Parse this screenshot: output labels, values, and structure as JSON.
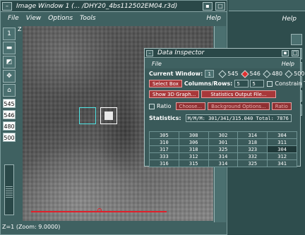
{
  "image_window": {
    "title": "Image Window 1 (... /DHY20_4bs112502EM04.r3d)",
    "menu": [
      "File",
      "View",
      "Options",
      "Tools"
    ],
    "help": "Help",
    "z_label": "Z",
    "tool_number": "1",
    "wavelengths": [
      "545",
      "546",
      "480",
      "500"
    ],
    "status": "Z=1  (Zoom: 9.0000)"
  },
  "right_window": {
    "help": "Help"
  },
  "inspector": {
    "title": "Data Inspector",
    "menu_file": "File",
    "menu_help": "Help",
    "current_window_label": "Current Window:",
    "current_window_value": "1",
    "channels": [
      {
        "label": "545",
        "selected": false
      },
      {
        "label": "546",
        "selected": true
      },
      {
        "label": "480",
        "selected": false
      },
      {
        "label": "500",
        "selected": false
      }
    ],
    "select_box": "Select Box",
    "columns_rows_label": "Columns/Rows:",
    "columns": "5",
    "rows": "5",
    "constrain": "Constrain To",
    "show_3d": "Show 3D Graph...",
    "stats_output": "Statistics Output File...",
    "ratio_label": "Ratio",
    "choose": "Choose...",
    "background_options": "Background Options...",
    "ratio_button": "Ratio",
    "statistics_label": "Statistics:",
    "statistics_value": "M/M/M: 301/341/315.040 Total: 7876 S",
    "grid": [
      [
        "305",
        "308",
        "302",
        "314",
        "304"
      ],
      [
        "310",
        "306",
        "301",
        "318",
        "311"
      ],
      [
        "317",
        "318",
        "325",
        "323",
        "304"
      ],
      [
        "333",
        "312",
        "314",
        "332",
        "312"
      ],
      [
        "316",
        "315",
        "314",
        "325",
        "341"
      ]
    ]
  }
}
